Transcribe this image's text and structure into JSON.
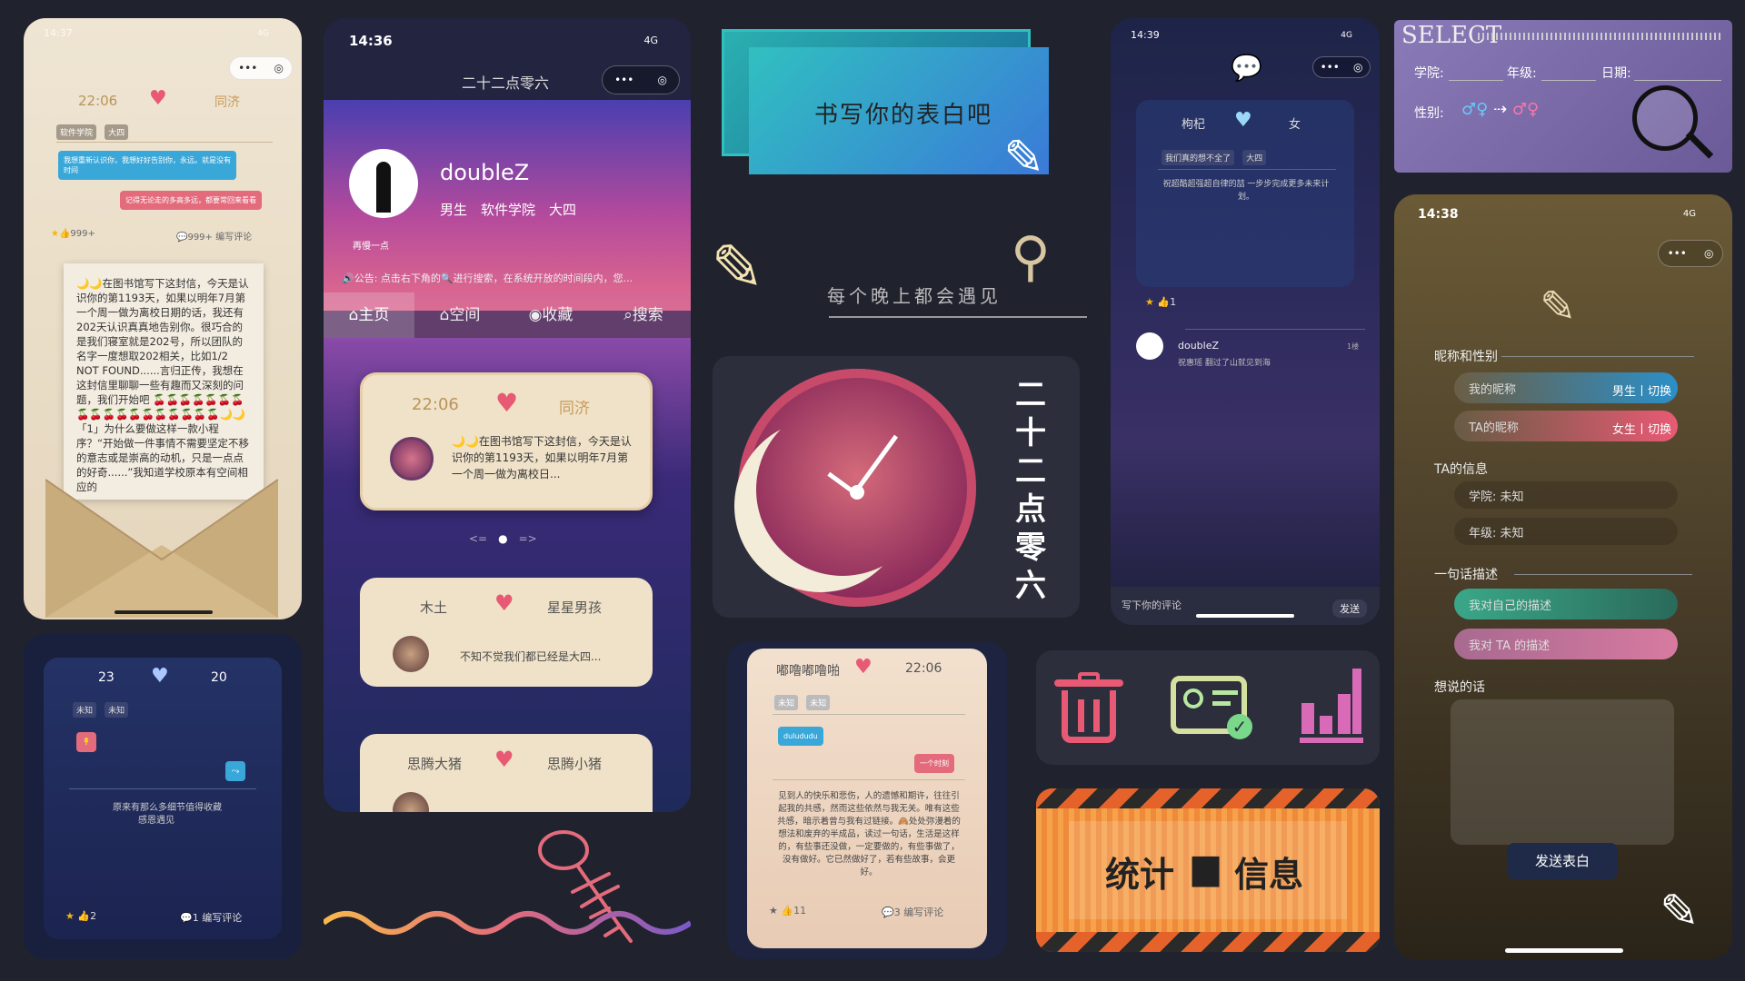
{
  "card1": {
    "status_time": "14:37",
    "status_net": "4G",
    "time": "22:06",
    "school": "同济",
    "tags": [
      "软件学院",
      "大四"
    ],
    "bubble_left": "我想重新认识你，我想好好告别你，永远。就是没有时间",
    "bubble_right": "记得无论走的多高多远，都要常回来看看",
    "likes": "999+",
    "comments": "999+",
    "write_comment": "编写评论",
    "letter": "🌙🌙在图书馆写下这封信，今天是认识你的第1193天，如果以明年7月第一个周一做为离校日期的话，我还有202天认识真真地告别你。很巧合的是我们寝室就是202号，所以团队的名字一度想取202相关，比如1/2 NOT FOUND......言归正传，我想在这封信里聊聊一些有趣而又深刻的问题，我们开始吧 🍒🍒🍒🍒🍒🍒🍒🍒🍒🍒🍒🍒🍒🍒🍒🍒🍒🍒🌙🌙「1」为什么要做这样一款小程序？“开始做一件事情不需要坚定不移的意志或是崇高的动机，只是一点点的好奇......”我知道学校原本有空间相应的"
  },
  "card2": {
    "status_time": "14:36",
    "status_net": "4G",
    "nav_title": "二十二点零六",
    "username": "doubleZ",
    "profile": "男生　软件学院　大四",
    "motto": "再慢一点",
    "notice": "公告: 点击右下角的🔍进行搜索，在系统开放的时间段内，您...",
    "tabs": [
      "主页",
      "空间",
      "收藏",
      "搜索"
    ],
    "feature": {
      "time": "22:06",
      "school": "同济",
      "text": "🌙🌙在图书馆写下这封信，今天是认识你的第1193天，如果以明年7月第一个周一做为离校日..."
    },
    "pager_prev": "<=",
    "pager_next": "=>",
    "post1": {
      "left": "木土",
      "right": "星星男孩",
      "text": "不知不觉我们都已经是大四..."
    },
    "post2": {
      "left": "思腾大猪",
      "right": "思腾小猪"
    }
  },
  "card3": {
    "left_num": "23",
    "right_num": "20",
    "tags": [
      "未知",
      "未知"
    ],
    "text1": "原来有那么多细节值得收藏",
    "text2": "感恩遇见",
    "likes": "2",
    "comments": "1",
    "write_comment": "编写评论"
  },
  "banner": {
    "text": "书写你的表白吧"
  },
  "slogan": {
    "text": "每个晚上都会遇见"
  },
  "logo_vertical": [
    "二",
    "十",
    "二",
    "点",
    "零",
    "六"
  ],
  "card4": {
    "sender": "嘟噜嘟噜啪",
    "time": "22:06",
    "tags": [
      "未知",
      "未知"
    ],
    "bubble_left": "dulududu",
    "bubble_right": "一个时刻",
    "text": "见到人的快乐和悲伤，人的遗憾和期许，往往引起我的共感，然而这些依然与我无关。唯有这些共感，暗示着曾与我有过链接。🙈处处弥漫着的想法和废弃的半成品，读过一句话，生活是这样的，有些事还没做，一定要做的，有些事做了，没有做好。它已然做好了，若有些故事，会更好。",
    "likes": "11",
    "comments": "3",
    "write_comment": "编写评论"
  },
  "stats": {
    "text": "统计",
    "text2": "信息"
  },
  "card5": {
    "status_time": "14:39",
    "status_net": "4G",
    "left_name": "枸杞",
    "right_name": "女",
    "tags": [
      "我们真的想不全了",
      "大四"
    ],
    "body": "祝超酷超强超自律的喆 一步步完成更多未来计划。",
    "likes": "1",
    "comment_user": "doubleZ",
    "comment_text": "祝惠瑶 翻过了山就见到海",
    "comment_floor": "1楼",
    "input_placeholder": "写下你的评论",
    "send": "发送"
  },
  "select": {
    "title": "SELECT",
    "college": "学院:",
    "grade": "年级:",
    "date": "日期:",
    "gender": "性别:"
  },
  "card6": {
    "status_time": "14:38",
    "status_net": "4G",
    "section1": "昵称和性别",
    "my_nick": "我的昵称",
    "my_btn": "男生丨切换",
    "ta_nick": "TA的昵称",
    "ta_btn": "女生丨切换",
    "section2": "TA的信息",
    "college": "学院: 未知",
    "grade": "年级: 未知",
    "section3": "一句话描述",
    "desc_self": "我对自己的描述",
    "desc_ta": "我对 TA 的描述",
    "section4": "想说的话",
    "submit": "发送表白"
  },
  "colors": {
    "bg": "#20222e",
    "heart": "#e85a74",
    "blue": "#3aa7d9",
    "pink": "#e85a74",
    "gold": "#b8955a"
  }
}
